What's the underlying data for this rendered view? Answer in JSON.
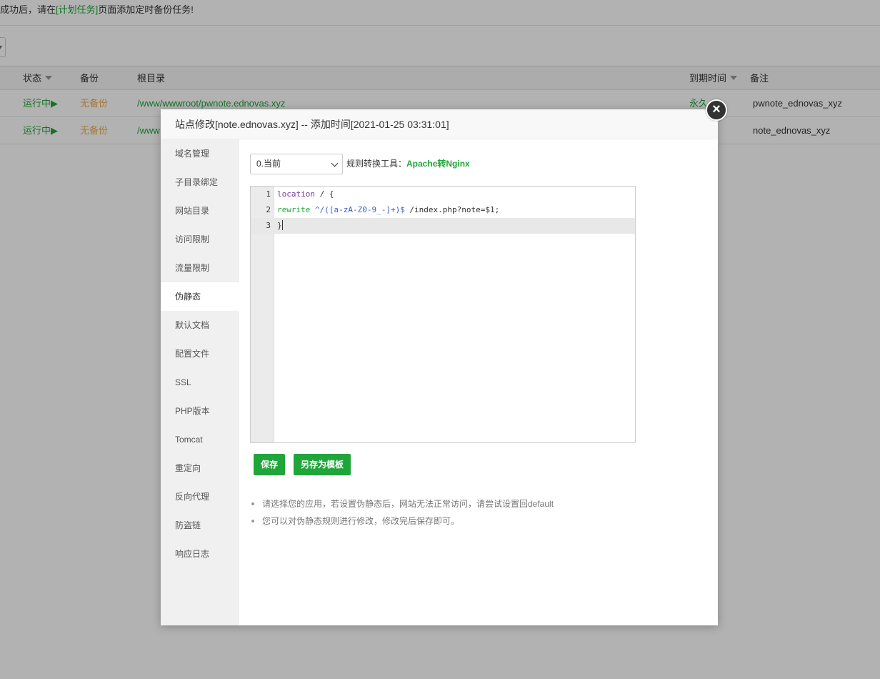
{
  "notice": {
    "before": "成功后，请在",
    "link": "[计划任务]",
    "after": "页面添加定时备份任务!"
  },
  "table": {
    "headers": {
      "status": "状态",
      "backup": "备份",
      "root": "根目录",
      "expire": "到期时间",
      "remark": "备注"
    },
    "rows": [
      {
        "status": "运行中▶",
        "backup": "无备份",
        "root": "/www/wwwroot/pwnote.ednovas.xyz",
        "expire": "永久",
        "remark": "pwnote_ednovas_xyz"
      },
      {
        "status": "运行中▶",
        "backup": "无备份",
        "root": "/www",
        "expire": "",
        "remark": "note_ednovas_xyz"
      }
    ]
  },
  "dialog": {
    "title": "站点修改[note.ednovas.xyz] -- 添加时间[2021-01-25 03:31:01]",
    "close_glyph": "×",
    "sidebar": [
      {
        "label": "域名管理",
        "name": "domain"
      },
      {
        "label": "子目录绑定",
        "name": "subdir"
      },
      {
        "label": "网站目录",
        "name": "site-dir"
      },
      {
        "label": "访问限制",
        "name": "access-limit"
      },
      {
        "label": "流量限制",
        "name": "traffic-limit"
      },
      {
        "label": "伪静态",
        "name": "rewrite",
        "active": true
      },
      {
        "label": "默认文档",
        "name": "default-doc"
      },
      {
        "label": "配置文件",
        "name": "config-file"
      },
      {
        "label": "SSL",
        "name": "ssl"
      },
      {
        "label": "PHP版本",
        "name": "php-version"
      },
      {
        "label": "Tomcat",
        "name": "tomcat"
      },
      {
        "label": "重定向",
        "name": "redirect"
      },
      {
        "label": "反向代理",
        "name": "reverse-proxy"
      },
      {
        "label": "防盗链",
        "name": "hotlink"
      },
      {
        "label": "响应日志",
        "name": "response-log"
      }
    ],
    "rewrite": {
      "selected_rule": "0.当前",
      "tool_label": "规则转换工具：",
      "tool_link": "Apache转Nginx",
      "code_lines": [
        {
          "num": "1",
          "kw": "location",
          "rest": " / {"
        },
        {
          "num": "2",
          "kw": "rewrite",
          "rx": " ^/([a-zA-Z0-9_-]+)$",
          "rest": " /index.php?note=$1;"
        },
        {
          "num": "3",
          "rest": "}"
        }
      ],
      "save_label": "保存",
      "save_template_label": "另存为模板",
      "tips": [
        "请选择您的应用，若设置伪静态后，网站无法正常访问，请尝试设置回default",
        "您可以对伪静态规则进行修改，修改完后保存即可。"
      ]
    }
  },
  "colors": {
    "accent": "#20a53a",
    "warning": "#f0ad4e",
    "overlay": "rgba(0,0,0,0.3)"
  }
}
